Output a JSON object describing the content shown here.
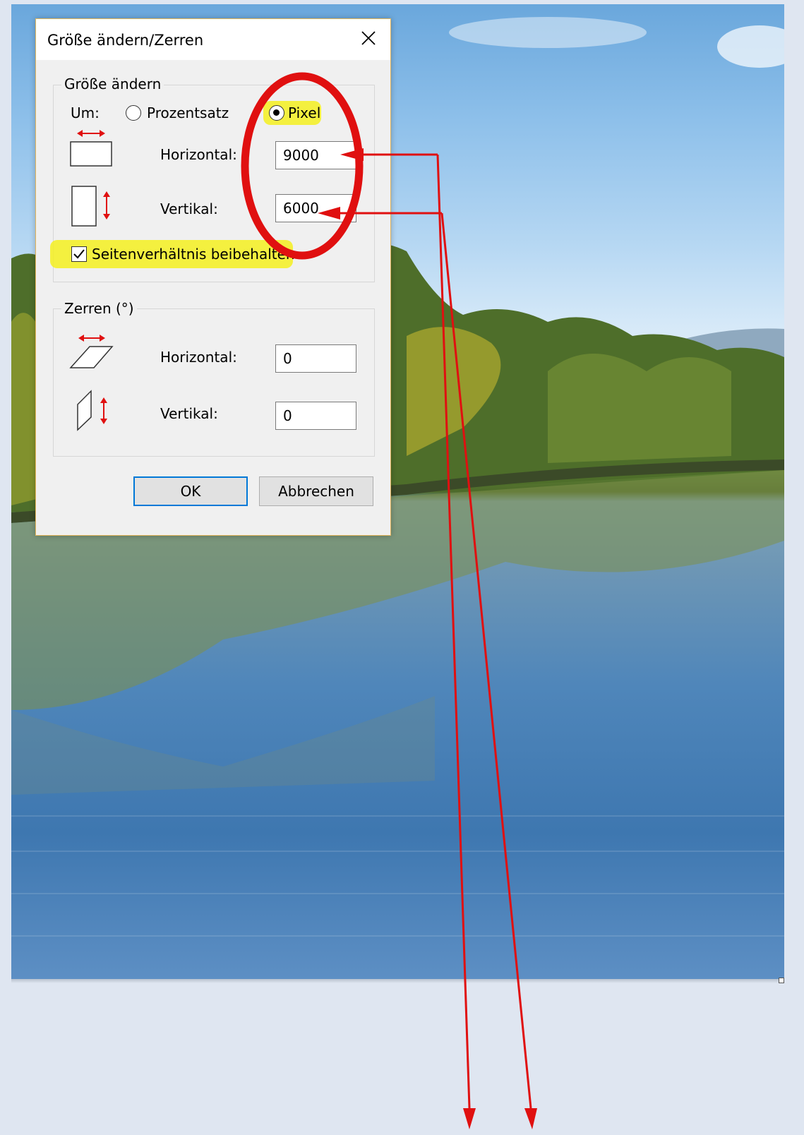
{
  "dialog": {
    "title": "Größe ändern/Zerren",
    "resize": {
      "legend": "Größe ändern",
      "by_label": "Um:",
      "options": [
        {
          "label": "Prozentsatz",
          "selected": false
        },
        {
          "label": "Pixel",
          "selected": true
        }
      ],
      "horizontal_label": "Horizontal:",
      "horizontal_value": "9000",
      "vertical_label": "Vertikal:",
      "vertical_value": "6000",
      "keep_ratio_label": "Seitenverhältnis beibehalten",
      "keep_ratio_checked": true
    },
    "skew": {
      "legend": "Zerren (°)",
      "horizontal_label": "Horizontal:",
      "horizontal_value": "0",
      "vertical_label": "Vertikal:",
      "vertical_value": "0"
    },
    "ok_label": "OK",
    "cancel_label": "Abbrechen"
  },
  "icons": {
    "close": "close-icon",
    "resize_horizontal": "resize-horizontal-icon",
    "resize_vertical": "resize-vertical-icon",
    "skew_horizontal": "skew-horizontal-icon",
    "skew_vertical": "skew-vertical-icon"
  },
  "colors": {
    "annotation_red": "#e01010",
    "highlight_yellow": "#f5f020",
    "focus_blue": "#0078d7",
    "dialog_border": "#e2b45a"
  }
}
